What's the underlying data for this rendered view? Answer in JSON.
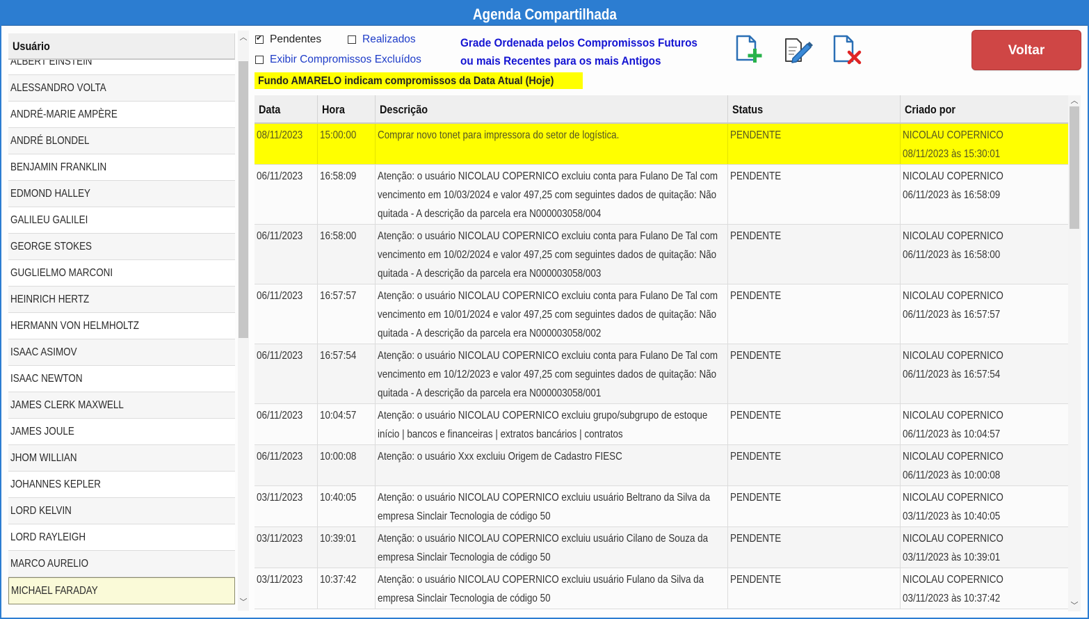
{
  "window": {
    "title": "Agenda Compartilhada"
  },
  "users": {
    "header": "Usuário",
    "items": [
      "ALBERT EINSTEIN",
      "ALESSANDRO VOLTA",
      "ANDRÉ-MARIE AMPÈRE",
      "ANDRÉ BLONDEL",
      "BENJAMIN FRANKLIN",
      "EDMOND HALLEY",
      "GALILEU GALILEI",
      "GEORGE STOKES",
      "GUGLIELMO MARCONI",
      "HEINRICH HERTZ",
      "HERMANN VON HELMHOLTZ",
      "ISAAC ASIMOV",
      "ISAAC NEWTON",
      "JAMES CLERK MAXWELL",
      "JAMES JOULE",
      "JHOM WILLIAN",
      "JOHANNES KEPLER",
      "LORD KELVIN",
      "LORD RAYLEIGH",
      "MARCO AURELIO",
      "MICHAEL FARADAY"
    ],
    "selected": "MICHAEL FARADAY"
  },
  "filters": {
    "pendentes": {
      "label": "Pendentes",
      "checked": true
    },
    "realizados": {
      "label": "Realizados",
      "checked": false
    },
    "excluidos": {
      "label": "Exibir Compromissos Excluídos",
      "checked": false
    }
  },
  "grid_info": {
    "line1": "Grade Ordenada pelos Compromissos Futuros",
    "line2": "ou mais Recentes para os mais Antigos"
  },
  "yellow_note": "Fundo AMARELO indicam compromissos da Data Atual (Hoje)",
  "toolbar": {
    "add_icon": "add-document-icon",
    "edit_icon": "edit-document-icon",
    "delete_icon": "delete-document-icon",
    "voltar_label": "Voltar"
  },
  "colors": {
    "title_bar": "#2c7dd1",
    "today_row": "#ffff00",
    "voltar_button": "#cf4645",
    "info_text": "#1414d2"
  },
  "grid": {
    "columns": [
      "Data",
      "Hora",
      "Descrição",
      "Status",
      "Criado por"
    ],
    "rows": [
      {
        "data": "08/11/2023",
        "hora": "15:00:00",
        "descricao": "Comprar novo tonet para impressora do setor de logística.",
        "status": "PENDENTE",
        "criado_user": "NICOLAU COPERNICO",
        "criado_em": "08/11/2023 às 15:30:01",
        "today": true
      },
      {
        "data": "06/11/2023",
        "hora": "16:58:09",
        "descricao": "Atenção: o usuário NICOLAU COPERNICO excluiu conta para Fulano De Tal com vencimento em 10/03/2024 e valor 497,25 com seguintes dados de quitação: Não quitada -  A descrição da parcela era N000003058/004",
        "status": "PENDENTE",
        "criado_user": "NICOLAU COPERNICO",
        "criado_em": "06/11/2023 às 16:58:09",
        "today": false
      },
      {
        "data": "06/11/2023",
        "hora": "16:58:00",
        "descricao": "Atenção: o usuário NICOLAU COPERNICO excluiu conta para Fulano De Tal com vencimento em 10/02/2024 e valor 497,25 com seguintes dados de quitação: Não quitada -  A descrição da parcela era N000003058/003",
        "status": "PENDENTE",
        "criado_user": "NICOLAU COPERNICO",
        "criado_em": "06/11/2023 às 16:58:00",
        "today": false
      },
      {
        "data": "06/11/2023",
        "hora": "16:57:57",
        "descricao": "Atenção: o usuário NICOLAU COPERNICO excluiu conta para Fulano De Tal com vencimento em 10/01/2024 e valor 497,25 com seguintes dados de quitação: Não quitada -  A descrição da parcela era N000003058/002",
        "status": "PENDENTE",
        "criado_user": "NICOLAU COPERNICO",
        "criado_em": "06/11/2023 às 16:57:57",
        "today": false
      },
      {
        "data": "06/11/2023",
        "hora": "16:57:54",
        "descricao": "Atenção: o usuário NICOLAU COPERNICO excluiu conta para Fulano De Tal com vencimento em 10/12/2023 e valor 497,25 com seguintes dados de quitação: Não quitada -  A descrição da parcela era N000003058/001",
        "status": "PENDENTE",
        "criado_user": "NICOLAU COPERNICO",
        "criado_em": "06/11/2023 às 16:57:54",
        "today": false
      },
      {
        "data": "06/11/2023",
        "hora": "10:04:57",
        "descricao": "Atenção: o usuário NICOLAU COPERNICO excluiu grupo/subgrupo de estoque início | bancos e financeiras | extratos bancários | contratos",
        "status": "PENDENTE",
        "criado_user": "NICOLAU COPERNICO",
        "criado_em": "06/11/2023 às 10:04:57",
        "today": false
      },
      {
        "data": "06/11/2023",
        "hora": "10:00:08",
        "descricao": "Atenção: o usuário Xxx excluiu Origem de Cadastro FIESC",
        "status": "PENDENTE",
        "criado_user": "NICOLAU COPERNICO",
        "criado_em": "06/11/2023 às 10:00:08",
        "today": false
      },
      {
        "data": "03/11/2023",
        "hora": "10:40:05",
        "descricao": "Atenção: o usuário NICOLAU COPERNICO excluiu usuário Beltrano da Silva da empresa Sinclair Tecnologia de código 50",
        "status": "PENDENTE",
        "criado_user": "NICOLAU COPERNICO",
        "criado_em": "03/11/2023 às 10:40:05",
        "today": false
      },
      {
        "data": "03/11/2023",
        "hora": "10:39:01",
        "descricao": "Atenção: o usuário NICOLAU COPERNICO excluiu usuário Cilano de Souza da empresa Sinclair Tecnologia de código 50",
        "status": "PENDENTE",
        "criado_user": "NICOLAU COPERNICO",
        "criado_em": "03/11/2023 às 10:39:01",
        "today": false
      },
      {
        "data": "03/11/2023",
        "hora": "10:37:42",
        "descricao": "Atenção: o usuário NICOLAU COPERNICO excluiu usuário Fulano da Silva da empresa Sinclair Tecnologia de código 50",
        "status": "PENDENTE",
        "criado_user": "NICOLAU COPERNICO",
        "criado_em": "03/11/2023 às 10:37:42",
        "today": false
      }
    ]
  }
}
